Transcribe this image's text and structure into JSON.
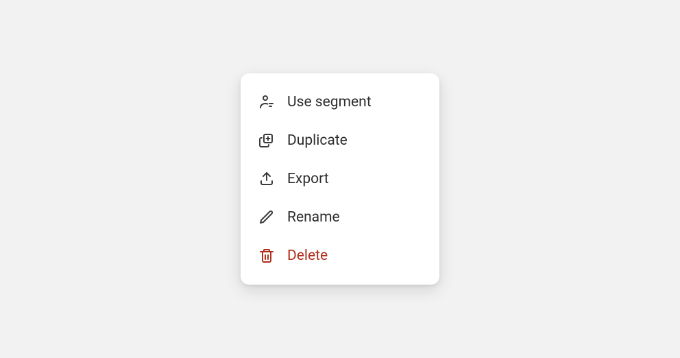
{
  "menu": {
    "items": [
      {
        "label": "Use segment",
        "icon": "user-segment-icon",
        "danger": false
      },
      {
        "label": "Duplicate",
        "icon": "duplicate-icon",
        "danger": false
      },
      {
        "label": "Export",
        "icon": "export-icon",
        "danger": false
      },
      {
        "label": "Rename",
        "icon": "rename-icon",
        "danger": false
      },
      {
        "label": "Delete",
        "icon": "trash-icon",
        "danger": true
      }
    ]
  },
  "colors": {
    "background": "#f2f2f2",
    "menu_bg": "#ffffff",
    "text": "#2d2d2d",
    "icon": "#3b3b3b",
    "danger": "#b02e1c"
  }
}
